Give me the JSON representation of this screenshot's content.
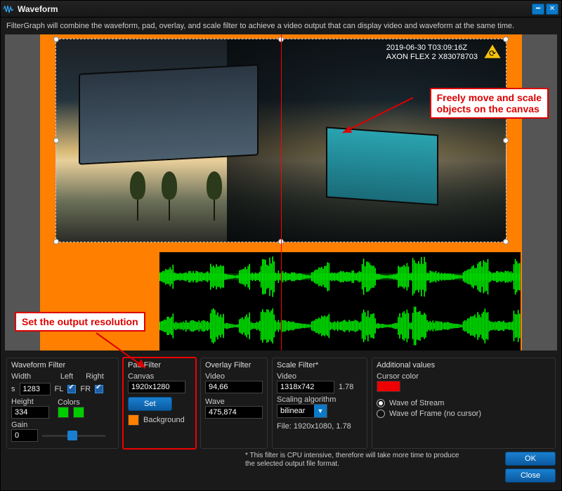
{
  "window": {
    "title": "Waveform"
  },
  "description": "FilterGraph will combine the waveform, pad, overlay, and scale filter to achieve a video output that can display video and waveform at the same time.",
  "annotations": {
    "move": "Freely move and scale\nobjects on the canvas",
    "resolution": "Set the output resolution"
  },
  "video_overlay": {
    "timestamp_line1": "2019-06-30 T03:09:16Z",
    "timestamp_line2": "AXON FLEX 2 X83078703"
  },
  "waveform_filter": {
    "title": "Waveform Filter",
    "width_label": "Width",
    "width_value": "1283",
    "width_unit": "s",
    "height_label": "Height",
    "height_value": "334",
    "gain_label": "Gain",
    "gain_value": "0",
    "left_label": "Left",
    "right_label": "Right",
    "fl_label": "FL",
    "fr_label": "FR",
    "colors_label": "Colors"
  },
  "pad_filter": {
    "title": "Pad Filter",
    "canvas_label": "Canvas",
    "canvas_value": "1920x1280",
    "set_label": "Set",
    "background_label": "Background"
  },
  "overlay_filter": {
    "title": "Overlay Filter",
    "video_label": "Video",
    "video_value": "94,66",
    "wave_label": "Wave",
    "wave_value": "475,874"
  },
  "scale_filter": {
    "title": "Scale Filter*",
    "video_label": "Video",
    "video_value": "1318x742",
    "ratio": "1.78",
    "alg_label": "Scaling algorithm",
    "alg_value": "bilinear",
    "file_label": "File: 1920x1080, 1.78"
  },
  "additional": {
    "title": "Additional values",
    "cursor_label": "Cursor color",
    "stream_label": "Wave of Stream",
    "frame_label": "Wave of Frame (no cursor)"
  },
  "footer": {
    "note": "* This filter is CPU intensive, therefore will take more time to produce the selected output file format.",
    "ok": "OK",
    "close": "Close"
  }
}
